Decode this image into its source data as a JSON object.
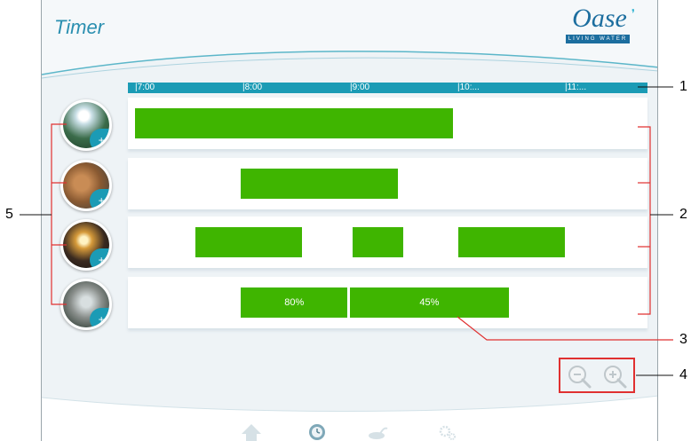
{
  "app": {
    "title": "Timer"
  },
  "logo": {
    "text": "Oase",
    "subtitle": "LIVING WATER"
  },
  "timeline": {
    "ticks": [
      "|7:00",
      "|8:00",
      "|9:00",
      "|10:...",
      "|11:..."
    ]
  },
  "lanes": [
    {
      "name": "zone-1",
      "bars": [
        {
          "label": "",
          "start": 0.0,
          "end": 0.63
        }
      ]
    },
    {
      "name": "zone-2",
      "bars": [
        {
          "label": "",
          "start": 0.21,
          "end": 0.52
        }
      ]
    },
    {
      "name": "zone-3",
      "bars": [
        {
          "label": "",
          "start": 0.12,
          "end": 0.33
        },
        {
          "label": "",
          "start": 0.43,
          "end": 0.53
        },
        {
          "label": "",
          "start": 0.64,
          "end": 0.85
        }
      ]
    },
    {
      "name": "zone-4",
      "bars": [
        {
          "label": "80%",
          "start": 0.21,
          "end": 0.42
        },
        {
          "label": "45%",
          "start": 0.425,
          "end": 0.74
        }
      ]
    }
  ],
  "zones": [
    {
      "icon": "fountain-image",
      "badge": "+"
    },
    {
      "icon": "stream-image",
      "badge": "+"
    },
    {
      "icon": "light-image",
      "badge": "+"
    },
    {
      "icon": "waterfall-image",
      "badge": "+"
    }
  ],
  "zoom": {
    "out_icon": "zoom-out-icon",
    "in_icon": "zoom-in-icon"
  },
  "nav": [
    {
      "icon": "home-icon"
    },
    {
      "icon": "clock-icon"
    },
    {
      "icon": "pump-icon"
    },
    {
      "icon": "settings-icon"
    }
  ],
  "callouts": {
    "c1": "1",
    "c2": "2",
    "c3": "3",
    "c4": "4",
    "c5": "5"
  },
  "colors": {
    "accent": "#1b9bb5",
    "bar": "#3fb500",
    "annotation": "#e03030",
    "title": "#2a8fb0"
  }
}
